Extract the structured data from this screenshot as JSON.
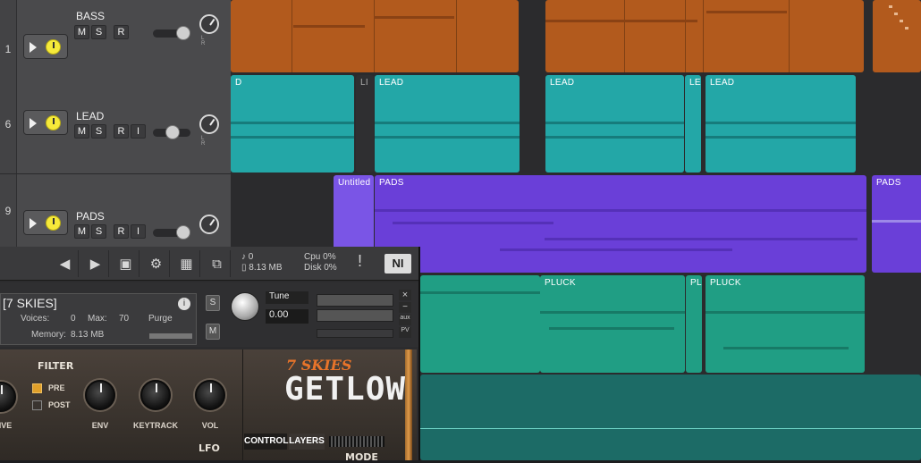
{
  "tracks": [
    {
      "number": "1",
      "name": "BASS",
      "buttons": [
        "M",
        "S",
        "R"
      ]
    },
    {
      "number": "6",
      "name": "LEAD",
      "buttons": [
        "M",
        "S",
        "R",
        "I"
      ]
    },
    {
      "number": "9",
      "name": "PADS",
      "buttons": [
        "M",
        "S",
        "R",
        "I"
      ]
    }
  ],
  "pan_labels": "L R",
  "clips": {
    "lead": [
      "D",
      "LI",
      "LEAD",
      "LEAD",
      "LE",
      "LEAD"
    ],
    "pads": [
      "Untitled",
      "PADS",
      "PADS"
    ],
    "pluck": [
      "PLUCK",
      "PL",
      "PLUCK"
    ]
  },
  "plugin": {
    "toolbar": {
      "voices_count": "0",
      "memory": "8.13 MB",
      "cpu_label": "Cpu",
      "cpu_value": "0%",
      "disk_label": "Disk",
      "disk_value": "0%",
      "alert": "!",
      "ni_logo": "NI"
    },
    "instrument": {
      "name": "[7 SKIES]",
      "voices_label": "Voices:",
      "voices_value": "0",
      "max_label": "Max:",
      "max_value": "70",
      "purge_label": "Purge",
      "memory_label": "Memory:",
      "memory_value": "8.13 MB",
      "s_button": "S",
      "m_button": "M",
      "tune_label": "Tune",
      "tune_value": "0.00",
      "close": "×",
      "minus": "−",
      "aux": "aux",
      "pv": "PV"
    },
    "body": {
      "filter_label": "FILTER",
      "pre_label": "PRE",
      "post_label": "POST",
      "knobs": [
        "IVE",
        "ENV",
        "KEYTRACK",
        "VOL"
      ],
      "lfo_label": "LFO",
      "mode_label": "MODE",
      "brand": "7 SKIES",
      "product": "GETLOW",
      "tabs": [
        "CONTROL",
        "LAYERS"
      ]
    }
  },
  "colors": {
    "bass": "#b25a1d",
    "lead": "#23a7a7",
    "pads": "#6a3fd8",
    "pluck": "#209e84",
    "power": "#f6ea3a"
  }
}
